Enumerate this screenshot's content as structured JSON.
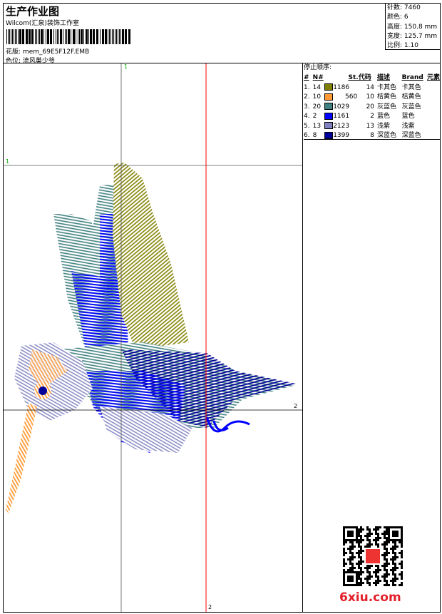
{
  "header": {
    "title": "生产作业图",
    "company": "Wilcom(汇泉)装饰工作室",
    "pattern_label": "花版:",
    "pattern_file": "mem_69E5F12F.EMB",
    "colorpos_label": "色位:",
    "colorpos_value": "流风巢少爷"
  },
  "stats": [
    {
      "label": "针数:",
      "value": "7460"
    },
    {
      "label": "颜色:",
      "value": "6"
    },
    {
      "label": "高度:",
      "value": "150.8 mm"
    },
    {
      "label": "宽度:",
      "value": "125.7 mm"
    },
    {
      "label": "比例:",
      "value": "1.10"
    }
  ],
  "stop_sequence": {
    "title": "停止顺序:",
    "headers": [
      "#",
      "N#",
      "St.",
      "代码",
      "描述",
      "Brand",
      "元素"
    ],
    "rows": [
      {
        "idx": "1.",
        "n": "14",
        "color": "#808000",
        "st": "1186",
        "code": "14",
        "desc": "卡其色",
        "brand": "卡其色"
      },
      {
        "idx": "2.",
        "n": "10",
        "color": "#FF9933",
        "st": "560",
        "code": "10",
        "desc": "桔黄色",
        "brand": "桔黄色"
      },
      {
        "idx": "3.",
        "n": "20",
        "color": "#3F7F7F",
        "st": "1029",
        "code": "20",
        "desc": "灰蓝色",
        "brand": "灰蓝色"
      },
      {
        "idx": "4.",
        "n": "2",
        "color": "#0000FF",
        "st": "1161",
        "code": "2",
        "desc": "蓝色",
        "brand": "蓝色"
      },
      {
        "idx": "5.",
        "n": "13",
        "color": "#8080C0",
        "st": "2123",
        "code": "13",
        "desc": "浅紫",
        "brand": "浅紫"
      },
      {
        "idx": "6.",
        "n": "8",
        "color": "#000099",
        "st": "1399",
        "code": "8",
        "desc": "深蓝色",
        "brand": "深蓝色"
      }
    ]
  },
  "markers": {
    "v1": "1",
    "h1": "1",
    "h2": "2",
    "v2": "2"
  },
  "watermark": "6xiu.com"
}
